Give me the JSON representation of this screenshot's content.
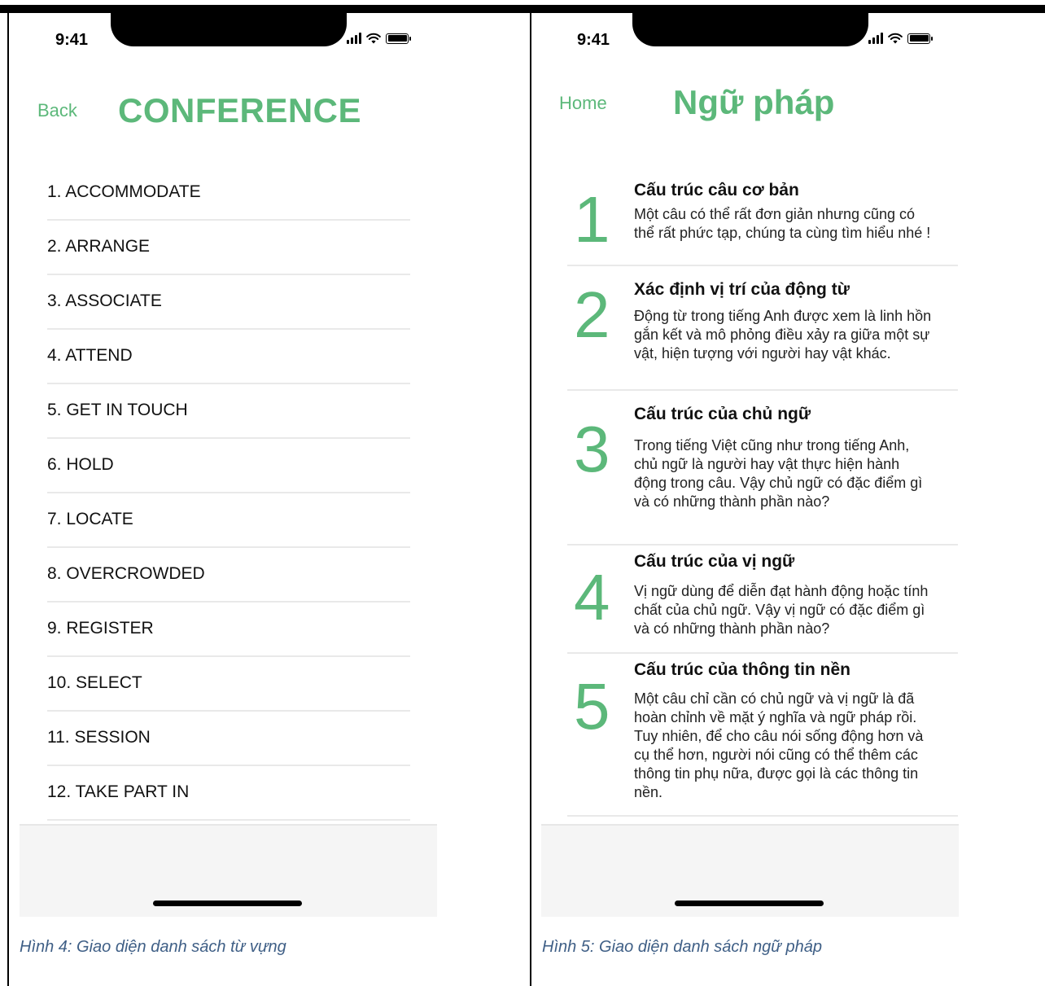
{
  "left_screen": {
    "status_time": "9:41",
    "back_label": "Back",
    "title": "CONFERENCE",
    "vocab_items": [
      "1. ACCOMMODATE",
      "2. ARRANGE",
      "3. ASSOCIATE",
      "4. ATTEND",
      "5. GET IN TOUCH",
      "6. HOLD",
      "7. LOCATE",
      "8. OVERCROWDED",
      "9. REGISTER",
      "10. SELECT",
      "11. SESSION",
      "12. TAKE PART IN"
    ],
    "caption": "Hình 4: Giao diện danh sách từ vựng"
  },
  "right_screen": {
    "status_time": "9:41",
    "home_label": "Home",
    "title": "Ngữ pháp",
    "grammar_items": [
      {
        "number": "1",
        "title": "Cấu trúc câu cơ bản",
        "description": "Một câu có thể rất đơn giản nhưng cũng có thể rất phức tạp, chúng ta cùng tìm hiểu nhé !"
      },
      {
        "number": "2",
        "title": "Xác định vị trí của động từ",
        "description": "Động từ trong tiếng Anh được xem là linh hồn gắn kết và mô phỏng điều xảy ra giữa một sự vật, hiện tượng với người hay vật khác."
      },
      {
        "number": "3",
        "title": "Cấu trúc của chủ ngữ",
        "description": "Trong tiếng Việt cũng như trong tiếng Anh, chủ ngữ là người hay vật thực hiện hành động trong câu. Vậy chủ ngữ có đặc điểm gì và có những thành phần nào?"
      },
      {
        "number": "4",
        "title": "Cấu trúc của vị ngữ",
        "description": "Vị ngữ dùng để diễn đạt hành động hoặc tính chất của chủ ngữ. Vậy vị ngữ có đặc điểm gì và có những thành phần nào?"
      },
      {
        "number": "5",
        "title": "Cấu trúc của thông tin nền",
        "description": "Một câu chỉ cần có chủ ngữ và vị ngữ là đã hoàn chỉnh về mặt ý nghĩa và ngữ pháp rồi. Tuy nhiên, để cho câu nói sống động hơn và cụ thể hơn, người nói cũng có thể thêm các thông tin phụ nữa, được gọi là các thông tin nền."
      }
    ],
    "caption": "Hình 5: Giao diện danh sách ngữ pháp"
  },
  "colors": {
    "accent": "#5cb87a",
    "caption": "#3f5f86",
    "divider": "#e9e9e9",
    "footer_bg": "#f5f5f5"
  },
  "icons": [
    "signal-icon",
    "wifi-icon",
    "battery-icon"
  ]
}
